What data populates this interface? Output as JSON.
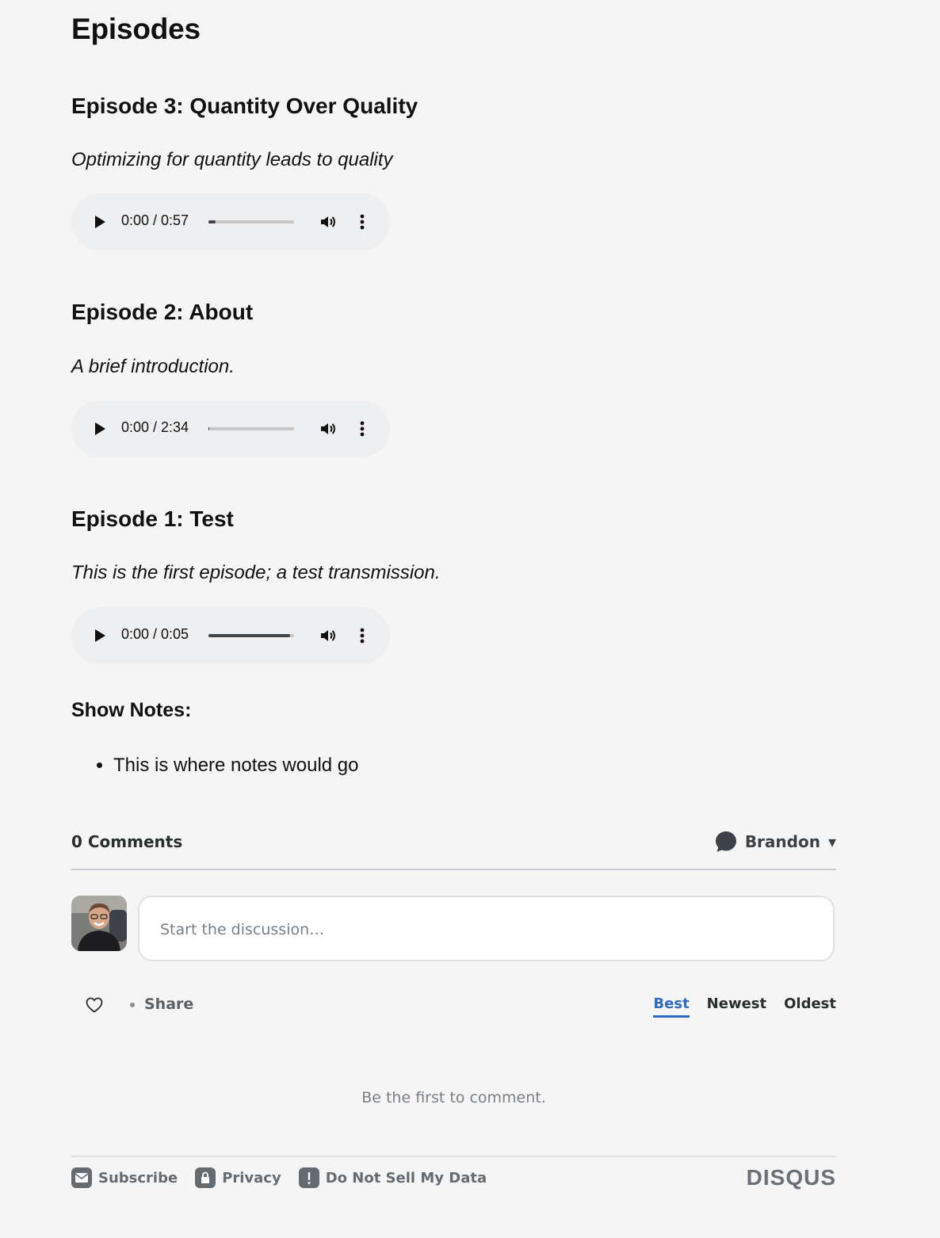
{
  "page": {
    "title": "Episodes"
  },
  "episodes": [
    {
      "title": "Episode 3: Quantity Over Quality",
      "description": "Optimizing for quantity leads to quality",
      "time": "0:00 / 0:57",
      "progress": 0.08
    },
    {
      "title": "Episode 2: About",
      "description": "A brief introduction.",
      "time": "0:00 / 2:34",
      "progress": 0.01
    },
    {
      "title": "Episode 1: Test",
      "description": "This is the first episode; a test transmission.",
      "time": "0:00 / 0:05",
      "progress": 0.95
    }
  ],
  "show_notes": {
    "heading": "Show Notes:",
    "items": [
      "This is where notes would go"
    ]
  },
  "comments": {
    "count_label": "0 Comments",
    "user_name": "Brandon",
    "user_caret": "▾",
    "placeholder": "Start the discussion…",
    "share_label": "Share",
    "sort": {
      "best": "Best",
      "newest": "Newest",
      "oldest": "Oldest",
      "active": "best"
    },
    "empty_text": "Be the first to comment.",
    "footer": {
      "subscribe": "Subscribe",
      "privacy": "Privacy",
      "do_not_sell": "Do Not Sell My Data"
    },
    "brand": "DISQUS",
    "accent_color": "#2e6bc2"
  }
}
